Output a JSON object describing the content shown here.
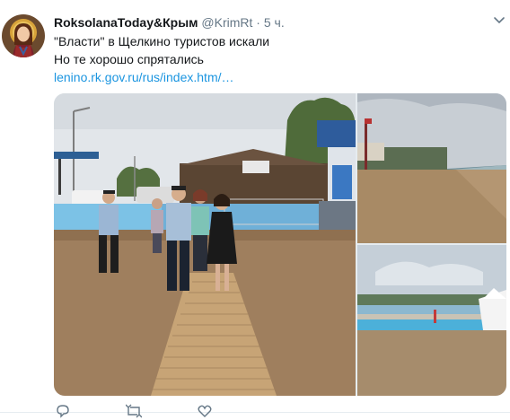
{
  "tweet": {
    "display_name": "RoksolanaToday&Крым",
    "handle": "@KrimRt",
    "separator": "·",
    "time": "5 ч.",
    "lines": [
      "\"Власти\" в Щелкино туристов искали",
      "Но те хорошо спрятались"
    ],
    "link": "lenino.rk.gov.ru/rus/index.htm/…"
  },
  "media": {
    "images": [
      "officials-walking-on-beach-boardwalk",
      "empty-beach-shoreline",
      "beach-promenade-with-tent"
    ]
  },
  "icons": {
    "caret": "chevron-down-icon",
    "reply": "reply-icon",
    "retweet": "retweet-icon",
    "like": "heart-icon"
  },
  "colors": {
    "name": "#14171a",
    "meta": "#657786",
    "link": "#1b95e0"
  }
}
